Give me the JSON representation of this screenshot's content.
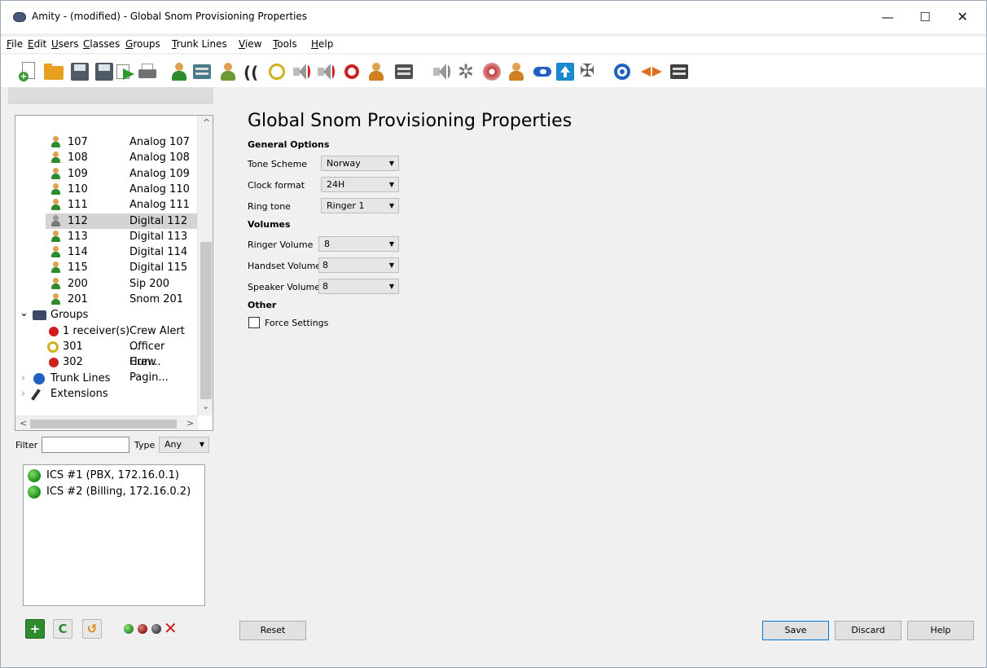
{
  "window": {
    "title": "Amity - (modified) - Global Snom Provisioning Properties",
    "minimize_glyph": "—",
    "maximize_glyph": "☐",
    "close_glyph": "✕"
  },
  "menu": {
    "file": {
      "underline": "F",
      "rest": "ile"
    },
    "edit": {
      "underline": "E",
      "rest": "dit"
    },
    "users": {
      "underline": "U",
      "rest": "sers"
    },
    "classes": {
      "underline": "C",
      "rest": "lasses"
    },
    "groups": {
      "underline": "G",
      "rest": "roups"
    },
    "trunk_lines": {
      "underline": "T",
      "rest": "runk Lines"
    },
    "view": {
      "underline": "V",
      "rest": "iew"
    },
    "tools": {
      "underline": "T",
      "rest": "ools"
    },
    "help": {
      "underline": "H",
      "rest": "elp"
    }
  },
  "toolbar_icons": [
    {
      "icon": "new-document-icon",
      "color": "#3a9a3a"
    },
    {
      "icon": "open-folder-icon",
      "color": "#e8a020"
    },
    {
      "icon": "save-disk-icon",
      "color": "#505a66"
    },
    {
      "icon": "save-as-disk-icon",
      "color": "#505a66"
    },
    {
      "icon": "export-icon",
      "color": "#2e9a2e"
    },
    {
      "icon": "print-icon",
      "color": "#707070"
    },
    {
      "icon": "add-user-icon",
      "color": "#2e8b2e"
    },
    {
      "icon": "user-card-icon",
      "color": "#4a7a8a"
    },
    {
      "icon": "users-group-icon",
      "color": "#6a9a30"
    },
    {
      "icon": "signal-icon",
      "color": "#2a2a2a"
    },
    {
      "icon": "hunt-group-icon",
      "color": "#d0b020"
    },
    {
      "icon": "speaker-icon",
      "color": "#cc2222"
    },
    {
      "icon": "speaker-add-icon",
      "color": "#cc2222"
    },
    {
      "icon": "alarm-icon",
      "color": "#cc2222"
    },
    {
      "icon": "user-pair-icon",
      "color": "#d08020"
    },
    {
      "icon": "phone-box-icon",
      "color": "#505050"
    },
    {
      "icon": "speaker-network-icon",
      "color": "#888888"
    },
    {
      "icon": "gear-icon",
      "color": "#707070"
    },
    {
      "icon": "disc-icon",
      "color": "#c04040"
    },
    {
      "icon": "user-network-icon",
      "color": "#d08020"
    },
    {
      "icon": "link-arrow-icon",
      "color": "#2060c0"
    },
    {
      "icon": "upload-arrow-icon",
      "color": "#1a8ad0"
    },
    {
      "icon": "tools-icon",
      "color": "#606060"
    },
    {
      "icon": "trunk-network-icon",
      "color": "#2060c0"
    },
    {
      "icon": "back-forward-icon",
      "color": "#e07020"
    },
    {
      "icon": "server-rack-icon",
      "color": "#404040"
    }
  ],
  "tree": {
    "users": [
      {
        "num": "107",
        "name": "Analog 107",
        "variant": "green"
      },
      {
        "num": "108",
        "name": "Analog 108",
        "variant": "green"
      },
      {
        "num": "109",
        "name": "Analog 109",
        "variant": "green"
      },
      {
        "num": "110",
        "name": "Analog 110",
        "variant": "green"
      },
      {
        "num": "111",
        "name": "Analog 111",
        "variant": "green"
      },
      {
        "num": "112",
        "name": "Digital 112",
        "variant": "gray",
        "selected": true
      },
      {
        "num": "113",
        "name": "Digital 113",
        "variant": "green"
      },
      {
        "num": "114",
        "name": "Digital 114",
        "variant": "green"
      },
      {
        "num": "115",
        "name": "Digital 115",
        "variant": "green"
      },
      {
        "num": "200",
        "name": "Sip 200",
        "variant": "green"
      },
      {
        "num": "201",
        "name": "Snom 201",
        "variant": "green"
      }
    ],
    "groups_label": "Groups",
    "groups": [
      {
        "num": "1 receiver(s)",
        "name": "Crew Alert ...",
        "icon": "alarm-icon"
      },
      {
        "num": "301",
        "name": "Officer Hun...",
        "icon": "hunt-group-icon"
      },
      {
        "num": "302",
        "name": "Crew Pagin...",
        "icon": "speaker-icon"
      }
    ],
    "trunk_lines_label": "Trunk Lines",
    "extensions_label": "Extensions",
    "expand_open": "⌄",
    "expand_closed": "›",
    "scroll_up": "^",
    "scroll_down": "⌄",
    "scroll_left": "<",
    "scroll_right": ">"
  },
  "filter": {
    "label": "Filter",
    "value": "",
    "type_label": "Type",
    "type_value": "Any",
    "caret": "▼"
  },
  "servers": [
    {
      "label": "ICS #1 (PBX, 172.16.0.1)",
      "status_color": "#2ea02e"
    },
    {
      "label": "ICS #2 (Billing, 172.16.0.2)",
      "status_color": "#2ea02e"
    }
  ],
  "bottom_controls": {
    "add": "+",
    "refresh": "C",
    "undo": "↺",
    "status_colors": [
      "#2ea02e",
      "#a02020",
      "#505050"
    ],
    "delete": "✕"
  },
  "main": {
    "title": "Global Snom Provisioning Properties",
    "sections": {
      "general": "General Options",
      "volumes": "Volumes",
      "other": "Other"
    },
    "fields": {
      "tone_scheme": {
        "label": "Tone Scheme",
        "value": "Norway"
      },
      "clock_format": {
        "label": "Clock format",
        "value": "24H"
      },
      "ring_tone": {
        "label": "Ring tone",
        "value": "Ringer 1"
      },
      "ringer_volume": {
        "label": "Ringer Volume",
        "value": "8"
      },
      "handset_volume": {
        "label": "Handset Volume",
        "value": "8"
      },
      "speaker_volume": {
        "label": "Speaker Volume",
        "value": "8"
      }
    },
    "force_settings": {
      "label": "Force Settings",
      "checked": false
    },
    "caret": "▼"
  },
  "buttons": {
    "reset": "Reset",
    "save": "Save",
    "discard": "Discard",
    "help": "Help"
  }
}
